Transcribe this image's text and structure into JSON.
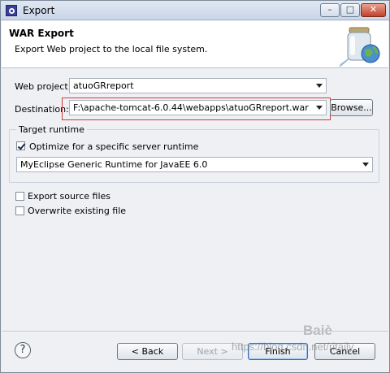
{
  "window": {
    "title": "Export",
    "minimize_glyph": "–",
    "maximize_glyph": "□",
    "close_glyph": "✕"
  },
  "banner": {
    "title": "WAR Export",
    "description": "Export Web project to the local file system.",
    "icon": "jar-globe-icon"
  },
  "form": {
    "web_project_label": "Web project:",
    "web_project_value": "atuoGRreport",
    "destination_label": "Destination:",
    "destination_value": "F:\\apache-tomcat-6.0.44\\webapps\\atuoGRreport.war",
    "browse_label": "Browse...",
    "target_runtime": {
      "legend": "Target runtime",
      "optimize_label": "Optimize for a specific server runtime",
      "optimize_checked": true,
      "runtime_value": "MyEclipse Generic Runtime for JavaEE 6.0"
    },
    "export_source_label": "Export source files",
    "export_source_checked": false,
    "overwrite_label": "Overwrite existing file",
    "overwrite_checked": false
  },
  "footer": {
    "help_glyph": "?",
    "back_label": "< Back",
    "next_label": "Next >",
    "finish_label": "Finish",
    "cancel_label": "Cancel"
  },
  "overlay": {
    "watermark_url": "https://blog.csdn.net/ritaily",
    "baidu_mark": "Baiè"
  },
  "colors": {
    "highlight_border": "#d23a3a",
    "window_bg": "#eef0f4"
  }
}
